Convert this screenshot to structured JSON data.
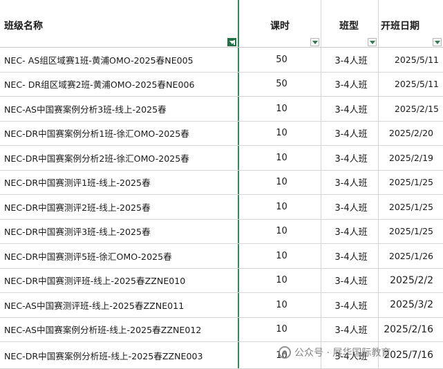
{
  "header": {
    "col_name": "班级名称",
    "col_hours": "课时",
    "col_type": "班型",
    "col_date": "开班日期"
  },
  "rows": [
    {
      "name": "NEC- AS组区域赛1班-黄浦OMO-2025春NE005",
      "hours": "50",
      "type": "3-4人班",
      "date": "2025/5/11"
    },
    {
      "name": "NEC- DR组区域赛2班-黄浦OMO-2025春NE006",
      "hours": "50",
      "type": "3-4人班",
      "date": "2025/5/11"
    },
    {
      "name": "NEC-AS中国赛案例分析3班-线上-2025春",
      "hours": "10",
      "type": "3-4人班",
      "date": "2025/2/15"
    },
    {
      "name": "NEC-DR中国赛案例分析1班-徐汇OMO-2025春",
      "hours": "10",
      "type": "3-4人班",
      "date": "2025/2/20"
    },
    {
      "name": "NEC-DR中国赛案例分析2班-徐汇OMO-2025春",
      "hours": "10",
      "type": "3-4人班",
      "date": "2025/2/19"
    },
    {
      "name": "NEC-DR中国赛测评1班-线上-2025春",
      "hours": "10",
      "type": "3-4人班",
      "date": "2025/1/25"
    },
    {
      "name": "NEC-DR中国赛测评2班-线上-2025春",
      "hours": "10",
      "type": "3-4人班",
      "date": "2025/1/25"
    },
    {
      "name": "NEC-DR中国赛测评3班-线上-2025春",
      "hours": "10",
      "type": "3-4人班",
      "date": "2025/1/25"
    },
    {
      "name": "NEC-DR中国赛测评5班-徐汇OMO-2025春",
      "hours": "10",
      "type": "3-4人班",
      "date": "2025/1/26"
    },
    {
      "name": "NEC-DR中国赛测评班-线上-2025春ZZNE010",
      "hours": "10",
      "type": "3-4人班",
      "date": "2025/2/2"
    },
    {
      "name": "NEC-AS中国赛测评班-线上-2025春ZZNE011",
      "hours": "10",
      "type": "3-4人班",
      "date": "2025/3/2"
    },
    {
      "name": "NEC-AS中国赛案例分析班-线上-2025春ZZNE012",
      "hours": "10",
      "type": "3-4人班",
      "date": "2025/2/16"
    },
    {
      "name": "NEC-DR中国赛案例分析班-线上-2025春ZZNE003",
      "hours": "10",
      "type": "3-4人班",
      "date": "2025/7/16"
    }
  ],
  "watermark": "公众号 · 展华国际教育",
  "colors": {
    "filter_active": "#217346",
    "column_border": "#2e8b57"
  }
}
